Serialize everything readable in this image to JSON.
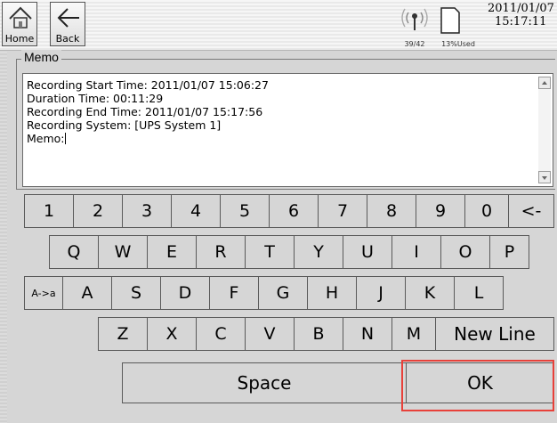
{
  "topbar": {
    "home_label": "Home",
    "back_label": "Back",
    "signal_text": "39/42",
    "storage_text": "13%Used",
    "date": "2011/01/07",
    "time": "15:17:11"
  },
  "memo": {
    "legend": "Memo",
    "lines": [
      "Recording Start Time: 2011/01/07 15:06:27",
      "Duration Time: 00:11:29",
      "Recording End Time: 2011/01/07 15:17:56",
      "Recording System: [UPS System 1]",
      "Memo:"
    ]
  },
  "keyboard": {
    "row1": [
      "1",
      "2",
      "3",
      "4",
      "5",
      "6",
      "7",
      "8",
      "9",
      "0",
      "<-"
    ],
    "row2": [
      "Q",
      "W",
      "E",
      "R",
      "T",
      "Y",
      "U",
      "I",
      "O",
      "P"
    ],
    "row3_toggle": "A->a",
    "row3": [
      "A",
      "S",
      "D",
      "F",
      "G",
      "H",
      "J",
      "K",
      "L"
    ],
    "row4": [
      "Z",
      "X",
      "C",
      "V",
      "B",
      "N",
      "M"
    ],
    "new_line": "New Line",
    "space": "Space",
    "ok": "OK"
  },
  "colors": {
    "highlight": "#e8413a",
    "key_bg": "#d6d6d6"
  }
}
